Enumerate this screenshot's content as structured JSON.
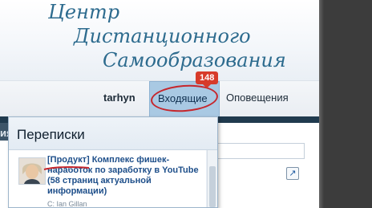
{
  "logo": {
    "line1": "Центр",
    "line2": "Дистанционного",
    "line3": "Самообразования"
  },
  "nav": {
    "username": "tarhyn",
    "inbox_label": "Входящие",
    "inbox_badge": "148",
    "notifications_label": "Оповещения"
  },
  "popup": {
    "title": "Переписки",
    "conversations": [
      {
        "title": "[Продукт] Комплекс фишек-наработок по заработку в YouTube (58 страниц актуальной информации)",
        "meta": "С: Ian Gillan"
      }
    ]
  },
  "page": {
    "left_text": "ия"
  },
  "colors": {
    "accent": "#2d6b8e",
    "badge": "#d73b2a",
    "annotation": "#c6262c",
    "link": "#1e4f8a",
    "tab_active": "#a9c9e3"
  }
}
